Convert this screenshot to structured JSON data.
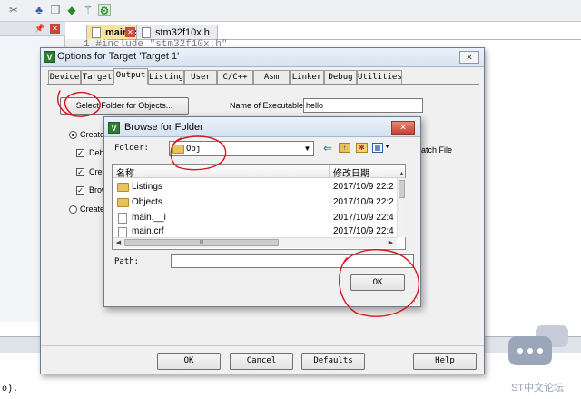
{
  "ide": {
    "file_tabs": [
      {
        "label": "main.c",
        "active": true
      },
      {
        "label": "stm32f10x.h",
        "active": false
      }
    ],
    "code_first_line": "1  #include \"stm32f10x.h\"",
    "output_snippet": "o)."
  },
  "options_dialog": {
    "title": "Options for Target 'Target 1'",
    "tabs": [
      "Device",
      "Target",
      "Output",
      "Listing",
      "User",
      "C/C++",
      "Asm",
      "Linker",
      "Debug",
      "Utilities"
    ],
    "active_tab": "Output",
    "select_folder_label": "Select Folder for Objects...",
    "exe_name_label": "Name of Executable:",
    "exe_name_value": "hello",
    "create_exec_label": "Create",
    "debug_check_label": "Deb",
    "create_hex_label": "Crea",
    "browse_info_label": "Brow",
    "create_lib_label": "Create",
    "batch_label": "atch File",
    "buttons": {
      "ok": "OK",
      "cancel": "Cancel",
      "defaults": "Defaults",
      "help": "Help"
    }
  },
  "browse_dialog": {
    "title": "Browse for Folder",
    "folder_label": "Folder:",
    "folder_value": "Obj",
    "columns": {
      "name": "名称",
      "date": "修改日期"
    },
    "rows": [
      {
        "name": "Listings",
        "date": "2017/10/9 22:2",
        "type": "folder"
      },
      {
        "name": "Objects",
        "date": "2017/10/9 22:2",
        "type": "folder"
      },
      {
        "name": "main.__i",
        "date": "2017/10/9 22:4",
        "type": "file"
      },
      {
        "name": "main.crf",
        "date": "2017/10/9 22:4",
        "type": "file"
      }
    ],
    "hscroll_grip": "III",
    "path_label": "Path:",
    "path_value": "",
    "ok_label": "OK"
  },
  "watermark": {
    "text": "ST中文论坛"
  },
  "colors": {
    "annotation": "#d9151b",
    "title_gradient": "#d7e3f1",
    "close_red": "#c9412f"
  }
}
